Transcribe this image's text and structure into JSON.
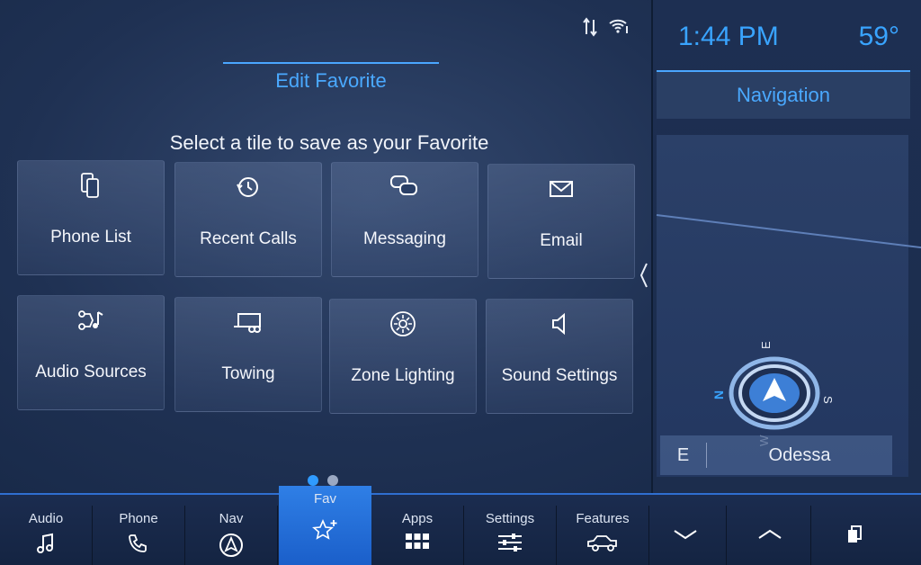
{
  "status": {
    "icons": [
      "data-transfer-icon",
      "wifi-icon"
    ]
  },
  "header": {
    "title": "Edit Favorite"
  },
  "prompt": "Select a tile to save as your Favorite",
  "tiles": [
    {
      "label": "Phone List",
      "icon": "phone-list-icon"
    },
    {
      "label": "Recent Calls",
      "icon": "recent-calls-icon"
    },
    {
      "label": "Messaging",
      "icon": "messaging-icon"
    },
    {
      "label": "Email",
      "icon": "email-icon"
    },
    {
      "label": "Audio Sources",
      "icon": "audio-sources-icon"
    },
    {
      "label": "Towing",
      "icon": "towing-icon"
    },
    {
      "label": "Zone Lighting",
      "icon": "zone-lighting-icon"
    },
    {
      "label": "Sound Settings",
      "icon": "sound-settings-icon"
    }
  ],
  "pagination": {
    "pages": 2,
    "current": 1
  },
  "side": {
    "time": "1:44 PM",
    "temperature": "59°",
    "panel_title": "Navigation",
    "compass_letters": [
      "E",
      "S",
      "N",
      "W"
    ],
    "heading": "E",
    "street": "Odessa"
  },
  "bottom_nav": [
    {
      "label": "Audio",
      "icon": "music-note-icon"
    },
    {
      "label": "Phone",
      "icon": "phone-icon"
    },
    {
      "label": "Nav",
      "icon": "navigation-icon"
    },
    {
      "label": "Fav",
      "icon": "star-plus-icon",
      "active": true
    },
    {
      "label": "Apps",
      "icon": "apps-grid-icon"
    },
    {
      "label": "Settings",
      "icon": "sliders-icon"
    },
    {
      "label": "Features",
      "icon": "truck-icon"
    }
  ],
  "controls": [
    "chevron-down-icon",
    "chevron-up-icon",
    "copy-icon"
  ],
  "colors": {
    "accent": "#39a4ff",
    "active_tab": "#2f7fe6",
    "background": "#1f3153"
  }
}
